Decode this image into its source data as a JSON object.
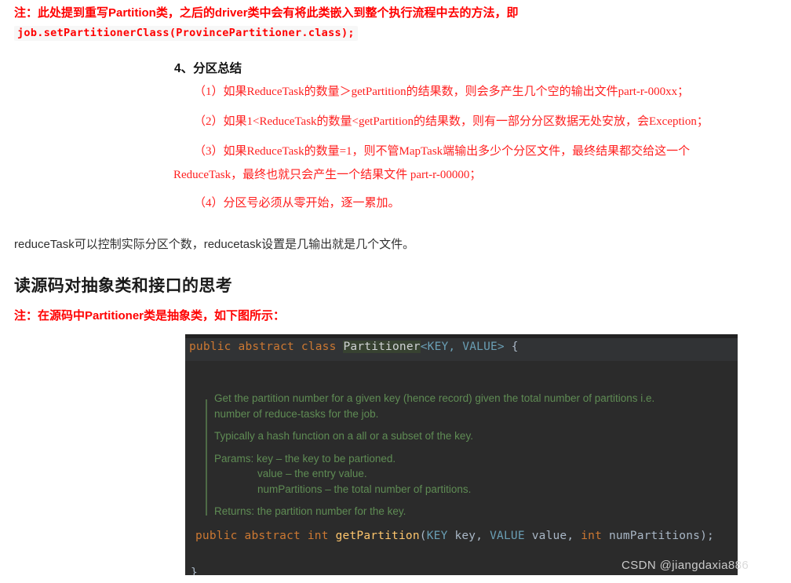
{
  "notes": {
    "top_note": "注：此处提到重写Partition类，之后的driver类中会有将此类嵌入到整个执行流程中去的方法，即",
    "top_code": "job.setPartitionerClass(ProvincePartitioner.class);",
    "source_note": "注：在源码中Partitioner类是抽象类，如下图所示："
  },
  "section": {
    "heading": "4、分区总结",
    "items": [
      "（1）如果ReduceTask的数量＞getPartition的结果数，则会多产生几个空的输出文件part-r-000xx；",
      "（2）如果1<ReduceTask的数量<getPartition的结果数，则有一部分分区数据无处安放，会Exception；",
      "（3）如果ReduceTask的数量=1，则不管MapTask端输出多少个分区文件，最终结果都交给这一个",
      "（4）分区号必须从零开始，逐一累加。"
    ],
    "item3_continuation": "ReduceTask，最终也就只会产生一个结果文件 part-r-00000；"
  },
  "paragraph": "reduceTask可以控制实际分区个数，reducetask设置是几输出就是几个文件。",
  "h2_heading": "读源码对抽象类和接口的思考",
  "code": {
    "signature": {
      "kw1": "public abstract class ",
      "class_name": "Partitioner",
      "generics": "<KEY, VALUE>",
      "brace": " {"
    },
    "javadoc": {
      "line1": "Get the partition number for a given key (hence record) given the total number of partitions i.e.",
      "line2": "number of reduce-tasks for the job.",
      "line3": "Typically a hash function on a all or a subset of the key.",
      "params_label": "Params:  key – the key to be partioned.",
      "param2": "value – the entry value.",
      "param3": "numPartitions – the total number of partitions.",
      "returns": "Returns: the partition number for the key."
    },
    "method": {
      "kw": "public abstract int ",
      "name": "getPartition",
      "paren_open": "(",
      "type1": "KEY",
      "arg1": " key",
      "comma1": ", ",
      "type2": "VALUE",
      "arg2": " value",
      "comma2": ", ",
      "type3": "int",
      "arg3": " numPartitions",
      "paren_close": ");"
    },
    "closing_brace": "}"
  },
  "watermark": "CSDN @jiangdaxia886",
  "colors": {
    "red": "#ff0000",
    "code_bg": "#2b2b2b",
    "code_header_bg": "#313335",
    "keyword": "#cc7832",
    "generic": "#6a9fb5",
    "comment": "#5f8c54",
    "method": "#ffc66d",
    "identifier": "#a9b7c6"
  }
}
